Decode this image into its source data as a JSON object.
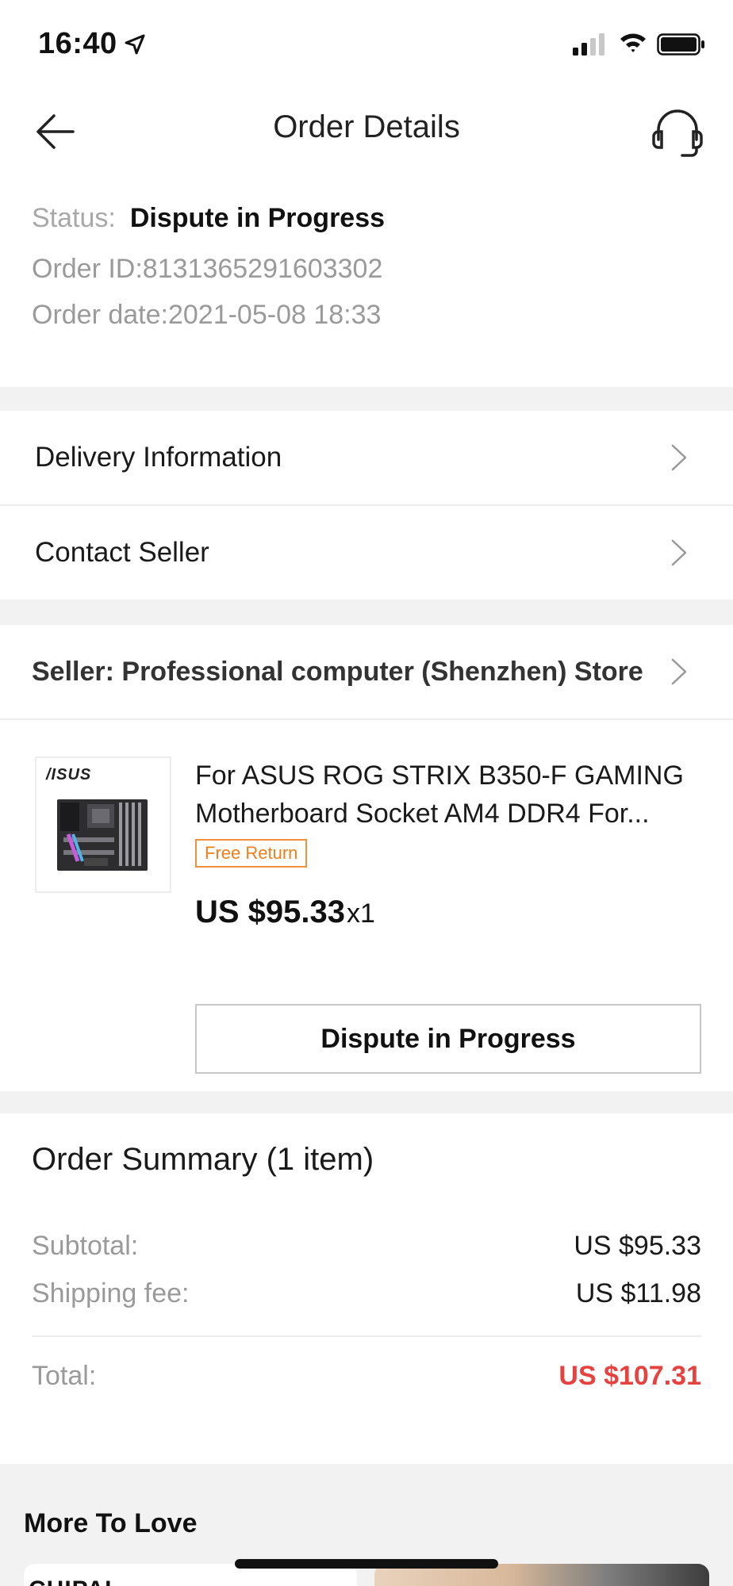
{
  "status_bar": {
    "time": "16:40"
  },
  "header": {
    "title": "Order Details",
    "back_icon": "arrow-left-icon",
    "support_icon": "headset-icon"
  },
  "order": {
    "status_label": "Status:",
    "status_value": "Dispute in Progress",
    "order_id": "Order ID:8131365291603302",
    "order_date": "Order date:2021-05-08 18:33"
  },
  "links": {
    "delivery": "Delivery Information",
    "contact": "Contact Seller"
  },
  "seller": {
    "label": "Seller: Professional computer (Shenzhen) Store"
  },
  "product": {
    "thumb_brand": "/ISUS",
    "title": "For ASUS ROG STRIX B350-F GAMING Motherboard Socket AM4 DDR4  For...",
    "badge": "Free Return",
    "price": "US $95.33",
    "qty": "x1",
    "action_button": "Dispute in Progress"
  },
  "summary": {
    "title": "Order Summary (1 item)",
    "subtotal_label": "Subtotal:",
    "subtotal_value": "US $95.33",
    "shipping_label": "Shipping fee:",
    "shipping_value": "US $11.98",
    "total_label": "Total:",
    "total_value": "US $107.31"
  },
  "more": {
    "title": "More To Love",
    "card_brand": "CHIPAI"
  },
  "colors": {
    "accent_red": "#e64340",
    "badge_orange": "#ef7f1a",
    "gap_gray": "#f2f2f2"
  }
}
